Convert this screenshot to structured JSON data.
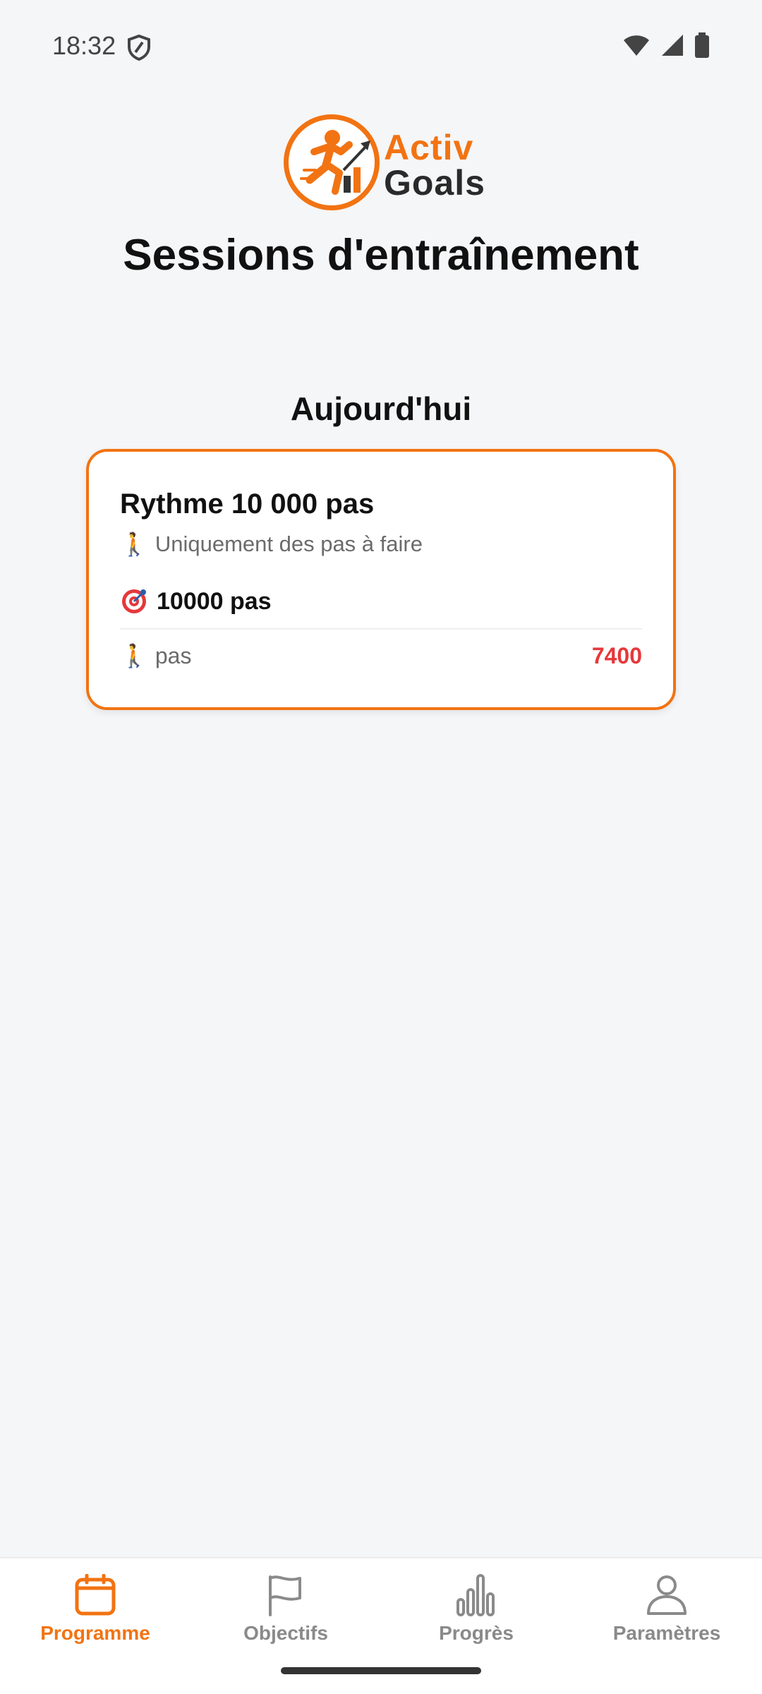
{
  "status_bar": {
    "time": "18:32",
    "icons": [
      "shield-icon",
      "wifi-icon",
      "signal-icon",
      "battery-icon"
    ]
  },
  "logo": {
    "line1": "Activ",
    "line2": "Goals",
    "brand_color": "#f27312"
  },
  "page_title": "Sessions d'entraînement",
  "section": {
    "title": "Aujourd'hui"
  },
  "session_card": {
    "title": "Rythme 10 000 pas",
    "subtitle_icon": "walking-icon",
    "subtitle": "Uniquement des pas à faire",
    "goal_icon": "target-icon",
    "goal": "10000 pas",
    "row": {
      "icon": "walking-icon",
      "label": "pas",
      "value": "7400",
      "value_color": "#e5383b"
    }
  },
  "bottom_nav": {
    "items": [
      {
        "label": "Programme",
        "icon": "calendar-icon",
        "active": true
      },
      {
        "label": "Objectifs",
        "icon": "flag-icon",
        "active": false
      },
      {
        "label": "Progrès",
        "icon": "bar-chart-icon",
        "active": false
      },
      {
        "label": "Paramètres",
        "icon": "user-icon",
        "active": false
      }
    ],
    "active_color": "#f27312",
    "inactive_color": "#8a8a8a"
  }
}
